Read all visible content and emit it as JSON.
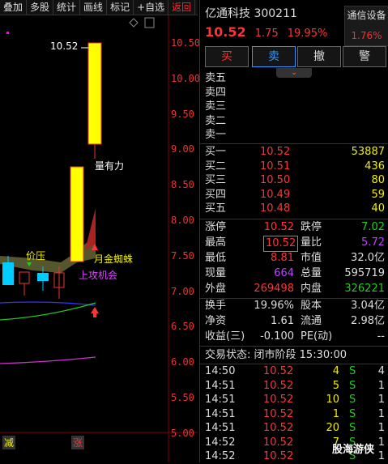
{
  "toolbar": [
    "叠加",
    "多股",
    "统计",
    "画线",
    "标记",
    "+自选",
    "返回"
  ],
  "chart": {
    "y_ticks": [
      "10.50",
      "10.00",
      "9.50",
      "9.00",
      "8.50",
      "8.00",
      "7.50",
      "7.00",
      "6.50",
      "6.00",
      "5.50",
      "5.00"
    ],
    "high_label": "10.52",
    "ann_volume": "量有力",
    "ann_price_pressure": "价压",
    "ann_spider": "月金蜘蛛",
    "ann_attack": "上攻机会",
    "bottom_left": "减",
    "bottom_mid": "涨"
  },
  "stock": {
    "name": "亿通科技",
    "code": "300211",
    "price": "10.52",
    "change": "1.75",
    "pct": "19.95%"
  },
  "sector": {
    "name": "通信设备",
    "pct": "1.76%"
  },
  "buttons": {
    "buy": "买",
    "sell": "卖",
    "cancel": "撤",
    "alert": "警"
  },
  "sell_levels": [
    "卖五",
    "卖四",
    "卖三",
    "卖二",
    "卖一"
  ],
  "buy_levels": [
    {
      "label": "买一",
      "price": "10.52",
      "vol": "53887"
    },
    {
      "label": "买二",
      "price": "10.51",
      "vol": "436"
    },
    {
      "label": "买三",
      "price": "10.50",
      "vol": "80"
    },
    {
      "label": "买四",
      "price": "10.49",
      "vol": "59"
    },
    {
      "label": "买五",
      "price": "10.48",
      "vol": "40"
    }
  ],
  "stats": {
    "l_limit_up": "涨停",
    "v_limit_up": "10.52",
    "l_limit_down": "跌停",
    "v_limit_down": "7.02",
    "l_high": "最高",
    "v_high": "10.52",
    "l_vol_ratio": "量比",
    "v_vol_ratio": "5.72",
    "l_low": "最低",
    "v_low": "8.81",
    "l_mktcap": "市值",
    "v_mktcap": "32.0亿",
    "l_cur_vol": "现量",
    "v_cur_vol": "664",
    "l_total_vol": "总量",
    "v_total_vol": "595719",
    "l_outer": "外盘",
    "v_outer": "269498",
    "l_inner": "内盘",
    "v_inner": "326221",
    "l_turnover": "换手",
    "v_turnover": "19.96%",
    "l_equity": "股本",
    "v_equity": "3.04亿",
    "l_net_assets": "净资",
    "v_net_assets": "1.61",
    "l_float": "流通",
    "v_float": "2.98亿",
    "l_eps": "收益(三)",
    "v_eps": "-0.100",
    "l_pe": "PE(动)",
    "v_pe": "--"
  },
  "status": {
    "label": "交易状态:",
    "value": "闭市阶段 15:30:00"
  },
  "ticks": [
    {
      "time": "14:50",
      "price": "10.52",
      "vol": "4",
      "side": "S",
      "n": "4"
    },
    {
      "time": "14:51",
      "price": "10.52",
      "vol": "5",
      "side": "S",
      "n": "1"
    },
    {
      "time": "14:51",
      "price": "10.52",
      "vol": "10",
      "side": "S",
      "n": "1"
    },
    {
      "time": "14:51",
      "price": "10.52",
      "vol": "1",
      "side": "S",
      "n": "1"
    },
    {
      "time": "14:51",
      "price": "10.52",
      "vol": "20",
      "side": "S",
      "n": "1"
    },
    {
      "time": "14:52",
      "price": "10.52",
      "vol": "7",
      "side": "S",
      "n": "1"
    },
    {
      "time": "14:52",
      "price": "10.52",
      "vol": "",
      "side": "S",
      "n": "1"
    }
  ],
  "watermark": "股海游侠",
  "colors": {
    "up": "#ff3333",
    "down": "#22cc22",
    "candle_up": "#ffff00",
    "bg": "#000000"
  }
}
